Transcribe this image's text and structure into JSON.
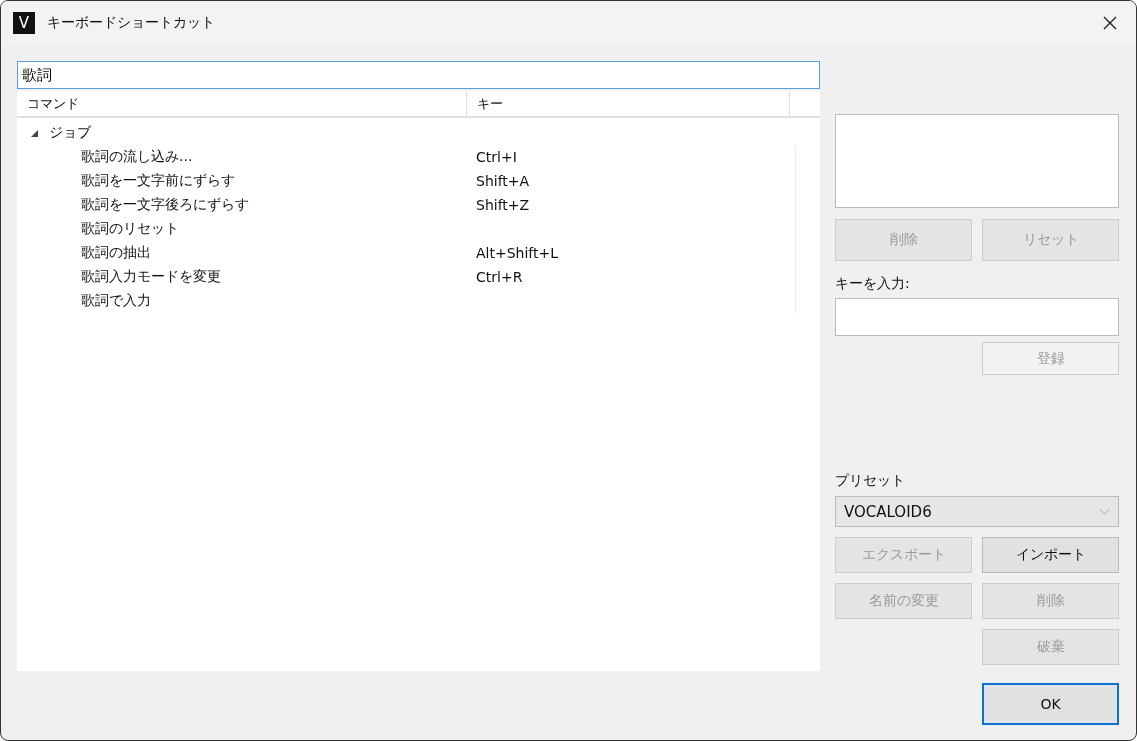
{
  "window": {
    "title": "キーボードショートカット",
    "logo_letter": "V"
  },
  "search": {
    "value": "歌詞"
  },
  "table": {
    "columns": [
      "コマンド",
      "キー"
    ],
    "groups": [
      {
        "label": "ジョブ",
        "expanded": true,
        "children": [
          {
            "command": "歌詞の流し込み...",
            "key": "Ctrl+I"
          },
          {
            "command": "歌詞を一文字前にずらす",
            "key": "Shift+A"
          },
          {
            "command": "歌詞を一文字後ろにずらす",
            "key": "Shift+Z"
          },
          {
            "command": "歌詞のリセット"
          },
          {
            "command": "歌詞の抽出",
            "key": "Alt+Shift+L"
          },
          {
            "command": "歌詞入力モードを変更",
            "key": "Ctrl+R"
          },
          {
            "command": "歌詞で入力"
          }
        ]
      }
    ]
  },
  "key_buttons": [
    {
      "label": "削除",
      "disabled": true
    },
    {
      "label": "リセット",
      "disabled": true
    }
  ],
  "key_input": {
    "label": "キーを入力:"
  },
  "register_button": {
    "label": "登録",
    "disabled": true
  },
  "preset": {
    "label": "プリセット",
    "value": "VOCALOID6"
  },
  "preset_buttons": [
    {
      "label": "エクスポート",
      "disabled": true
    },
    {
      "label": "インポート",
      "disabled": false
    },
    {
      "label": "名前の変更",
      "disabled": true
    },
    {
      "label": "削除",
      "disabled": true
    },
    {
      "label": "破棄",
      "disabled": true
    }
  ],
  "ok_button": {
    "label": "OK",
    "default": true
  }
}
